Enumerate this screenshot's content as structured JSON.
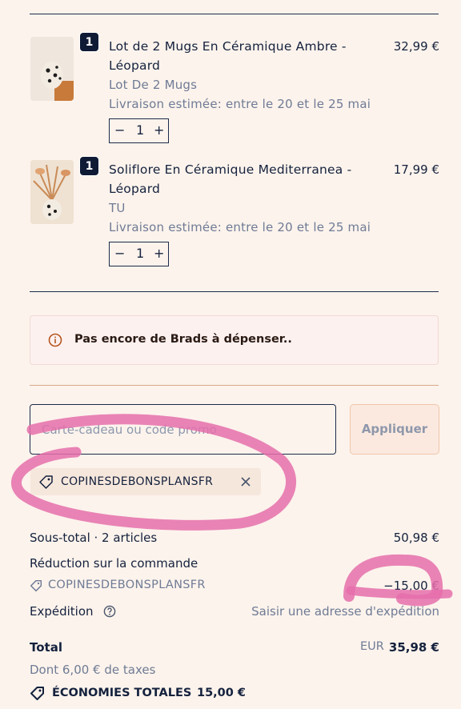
{
  "cart": {
    "items": [
      {
        "quantity_badge": "1",
        "title_line1": "Lot de 2 Mugs En Céramique Ambre -",
        "title_line2": "Léopard",
        "variant": "Lot De 2 Mugs",
        "delivery": "Livraison estimée: entre le 20 et le 25 mai",
        "price": "32,99 €",
        "qty_minus": "−",
        "qty_value": "1",
        "qty_plus": "+"
      },
      {
        "quantity_badge": "1",
        "title_line1": "Soliflore En Céramique Mediterranea -",
        "title_line2": "Léopard",
        "variant": "TU",
        "delivery": "Livraison estimée: entre le 20 et le 25 mai",
        "price": "17,99 €",
        "qty_minus": "−",
        "qty_value": "1",
        "qty_plus": "+"
      }
    ]
  },
  "notice": {
    "icon": "info-circle-icon",
    "text": "Pas encore de Brads à dépenser.."
  },
  "promo": {
    "placeholder": "Carte-cadeau ou code promo",
    "apply_label": "Appliquer",
    "applied_code": "COPINESDEBONSPLANSFR"
  },
  "summary": {
    "subtotal_label": "Sous-total · 2 articles",
    "subtotal_value": "50,98 €",
    "discount_label": "Réduction sur la commande",
    "discount_code": "COPINESDEBONSPLANSFR",
    "discount_value": "−15,00 €",
    "shipping_label": "Expédition",
    "shipping_value": "Saisir une adresse d'expédition",
    "total_label": "Total",
    "total_currency": "EUR",
    "total_value": "35,98 €",
    "taxes_note": "Dont 6,00 € de taxes",
    "savings_label": "ÉCONOMIES TOTALES",
    "savings_value": "15,00 €"
  },
  "colors": {
    "text": "#14213d",
    "muted": "#6f7b95",
    "background": "#fcf3ec",
    "marker": "#e56fab"
  }
}
